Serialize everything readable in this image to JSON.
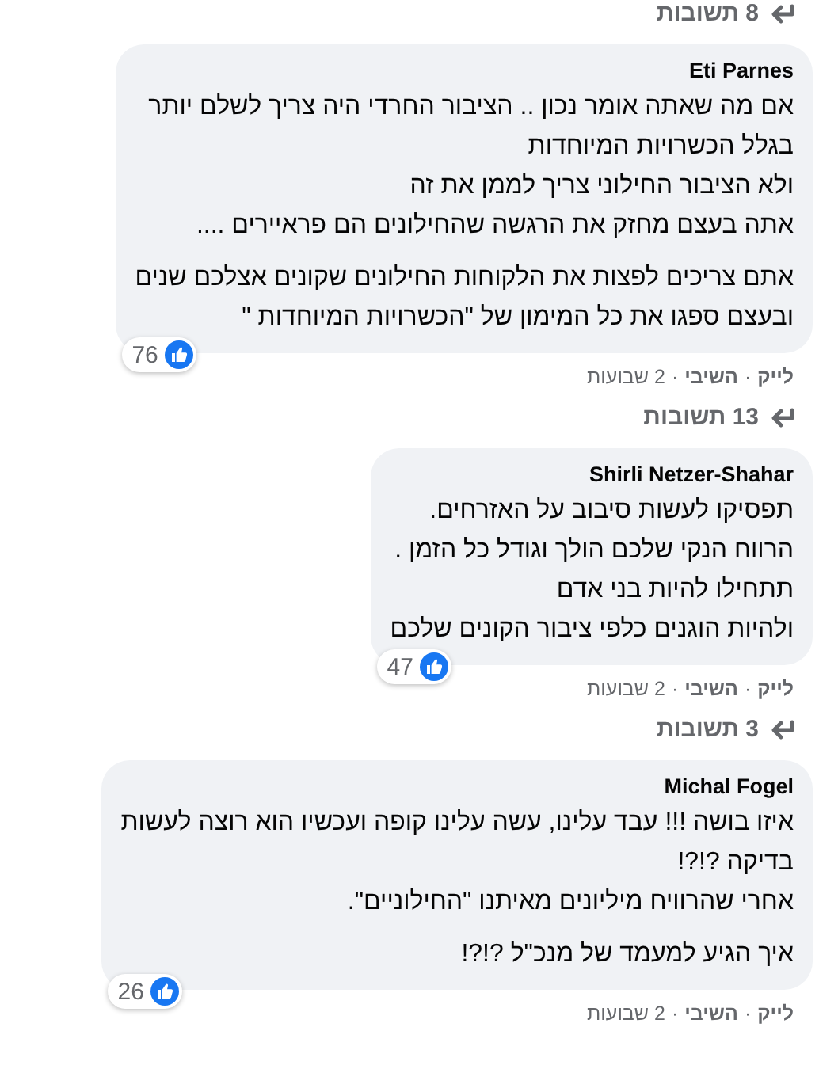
{
  "feed": [
    {
      "kind": "replies",
      "label": "8 תשובות"
    },
    {
      "kind": "comment",
      "author": "Eti Parnes",
      "paragraphs": [
        [
          "אם מה שאתה אומר נכון .. הציבור החרדי היה צריך לשלם יותר",
          "בגלל הכשרויות המיוחדות",
          "ולא הציבור החילוני צריך לממן את זה",
          "אתה בעצם מחזק את הרגשה שהחילונים הם פראיירים ...."
        ],
        [
          "אתם צריכים לפצות את הלקוחות החילונים שקונים אצלכם שנים",
          "ובעצם ספגו את כל המימון של \"הכשרויות המיוחדות \""
        ]
      ],
      "reactions": "76",
      "actions": [
        {
          "label": "לייק",
          "bold": true
        },
        {
          "label": "השיבי",
          "bold": true
        },
        {
          "label": "2 שבועות",
          "bold": false
        }
      ],
      "separator": "·"
    },
    {
      "kind": "replies",
      "label": "13 תשובות"
    },
    {
      "kind": "comment",
      "author": "Shirli Netzer-Shahar",
      "paragraphs": [
        [
          "תפסיקו לעשות סיבוב על האזרחים.",
          "הרווח הנקי שלכם הולך וגודל כל הזמן .",
          "תתחילו להיות בני אדם",
          "ולהיות הוגנים כלפי ציבור הקונים שלכם"
        ]
      ],
      "reactions": "47",
      "actions": [
        {
          "label": "לייק",
          "bold": true
        },
        {
          "label": "השיבי",
          "bold": true
        },
        {
          "label": "2 שבועות",
          "bold": false
        }
      ],
      "separator": "·"
    },
    {
      "kind": "replies",
      "label": "3 תשובות"
    },
    {
      "kind": "comment",
      "author": "Michal Fogel",
      "paragraphs": [
        [
          "איזו בושה !!! עבד עלינו, עשה עלינו קופה ועכשיו הוא רוצה לעשות",
          "בדיקה ?!?!",
          "אחרי שהרוויח מיליונים מאיתנו \"החילוניים\"."
        ],
        [
          "איך הגיע למעמד של מנכ\"ל ?!?!"
        ]
      ],
      "reactions": "26",
      "actions": [
        {
          "label": "לייק",
          "bold": true
        },
        {
          "label": "השיבי",
          "bold": true
        },
        {
          "label": "2 שבועות",
          "bold": false
        }
      ],
      "separator": "·"
    }
  ]
}
